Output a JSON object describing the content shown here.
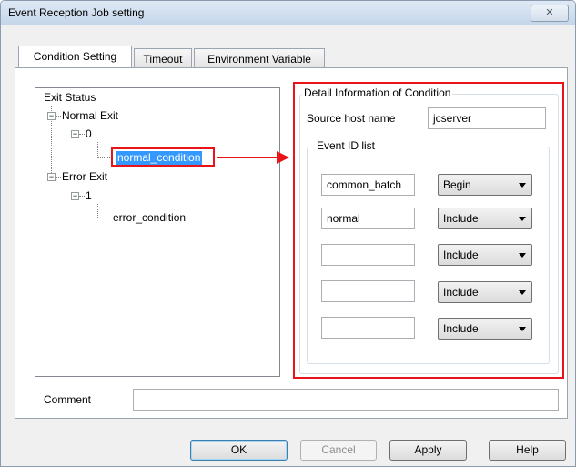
{
  "window": {
    "title": "Event Reception Job setting",
    "close_glyph": "✕"
  },
  "tabs": [
    {
      "label": "Condition Setting"
    },
    {
      "label": "Timeout"
    },
    {
      "label": "Environment Variable"
    }
  ],
  "tree": {
    "root": "Exit Status",
    "normal_exit": "Normal Exit",
    "normal_code": "0",
    "normal_condition": "normal_condition",
    "error_exit": "Error Exit",
    "error_code": "1",
    "error_condition": "error_condition",
    "expander_glyph": "−"
  },
  "detail": {
    "group_label": "Detail Information of Condition",
    "source_host_label": "Source host name",
    "source_host_value": "jcserver",
    "event_id_label": "Event ID list",
    "event_rows": [
      {
        "value": "common_batch",
        "mode": "Begin"
      },
      {
        "value": "normal",
        "mode": "Include"
      },
      {
        "value": "",
        "mode": "Include"
      },
      {
        "value": "",
        "mode": "Include"
      },
      {
        "value": "",
        "mode": "Include"
      }
    ]
  },
  "comment": {
    "label": "Comment",
    "value": ""
  },
  "buttons": {
    "ok": "OK",
    "cancel": "Cancel",
    "apply": "Apply",
    "help": "Help"
  },
  "colors": {
    "highlight": "#e8141a",
    "selection": "#3399ff"
  }
}
